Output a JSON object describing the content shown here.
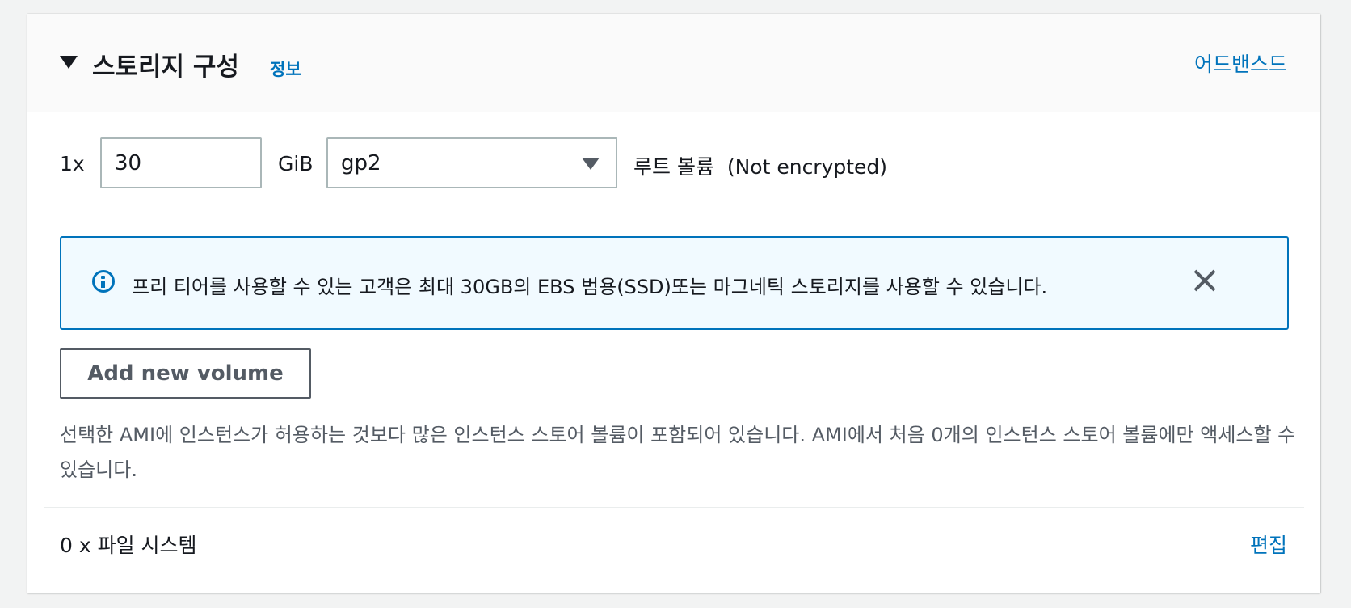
{
  "header": {
    "title": "스토리지 구성",
    "info_link": "정보",
    "advanced_link": "어드밴스드"
  },
  "volume": {
    "multiplier": "1x",
    "size_value": "30",
    "unit": "GiB",
    "type_value": "gp2",
    "root_label": "루트 볼륨  (Not encrypted)"
  },
  "alert": {
    "icon": "info-icon",
    "text": "프리 티어를 사용할 수 있는 고객은 최대 30GB의 EBS 범용(SSD)또는 마그네틱 스토리지를 사용할 수 있습니다."
  },
  "add_volume_label": "Add new volume",
  "instance_store_notice": "선택한 AMI에 인스턴스가 허용하는 것보다 많은 인스턴스 스토어 볼륨이 포함되어 있습니다. AMI에서 처음 0개의 인스턴스 스토어 볼륨에만 액세스할 수 있습니다.",
  "file_systems": {
    "label": "0 x 파일 시스템",
    "edit_link": "편집"
  },
  "colors": {
    "link": "#0073bb",
    "alert_background": "#f1faff",
    "page_background": "#f2f3f3"
  }
}
